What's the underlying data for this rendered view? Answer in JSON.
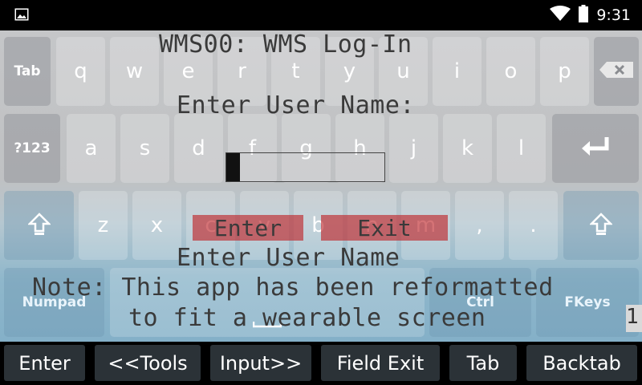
{
  "status_bar": {
    "time": "9:31",
    "icons": [
      "image-icon",
      "wifi-icon",
      "battery-icon"
    ]
  },
  "keyboard": {
    "row1": [
      "Tab",
      "q",
      "w",
      "e",
      "r",
      "t",
      "y",
      "u",
      "i",
      "o",
      "p",
      "backspace"
    ],
    "row2": [
      "?123",
      "a",
      "s",
      "d",
      "f",
      "g",
      "h",
      "j",
      "k",
      "l",
      "enter"
    ],
    "row3": [
      "shift",
      "z",
      "x",
      "c",
      "v",
      "b",
      "n",
      "m",
      ",",
      ".",
      "shift"
    ],
    "row4": [
      "Numpad",
      "space",
      "Ctrl",
      "FKeys"
    ]
  },
  "terminal": {
    "title": "WMS00: WMS Log-In",
    "prompt_label": "Enter User Name:",
    "enter_button": "Enter",
    "exit_button": "Exit",
    "hint": "Enter User Name",
    "note_line1": "Note: This app has been reformatted",
    "note_line2": "to fit a wearable screen",
    "page_indicator": "1"
  },
  "toolbar": {
    "enter": "Enter",
    "tools": "<<Tools",
    "input": "Input>>",
    "field_exit": "Field Exit",
    "tab": "Tab",
    "backtab": "Backtab"
  },
  "colors": {
    "key_face": "#d8d9db",
    "term_button": "#c8373c",
    "toolbar_button": "#2b3237"
  }
}
